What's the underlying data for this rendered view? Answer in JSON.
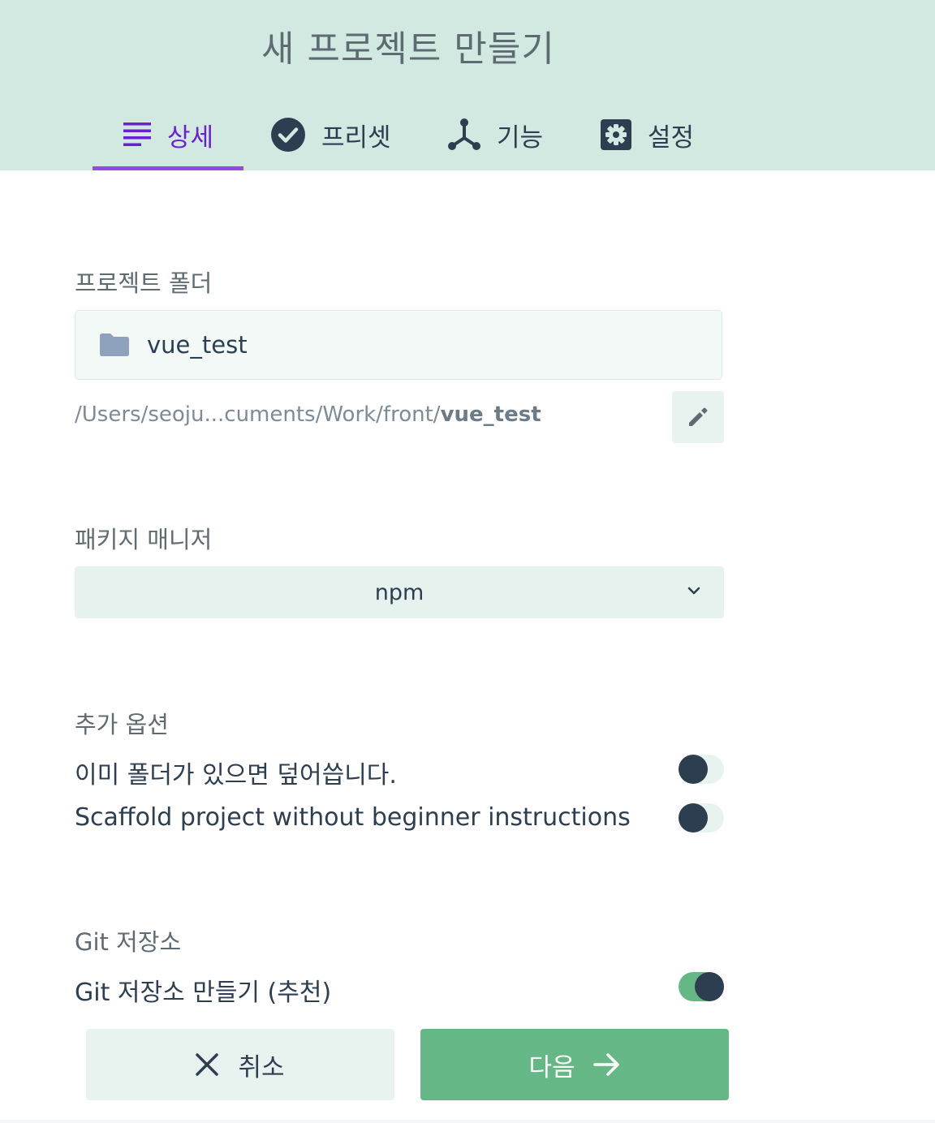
{
  "page": {
    "title": "새 프로젝트 만들기"
  },
  "tabs": [
    {
      "label": "상세",
      "icon": "list-icon",
      "active": true
    },
    {
      "label": "프리셋",
      "icon": "check-circle-icon",
      "active": false
    },
    {
      "label": "기능",
      "icon": "fork-icon",
      "active": false
    },
    {
      "label": "설정",
      "icon": "gear-icon",
      "active": false
    }
  ],
  "folder": {
    "label": "프로젝트 폴더",
    "value": "vue_test",
    "path_prefix": "/Users/seoju...cuments/Work/front/",
    "path_name": "vue_test"
  },
  "package_manager": {
    "label": "패키지 매니저",
    "selected": "npm"
  },
  "options": {
    "label": "추가 옵션",
    "items": [
      {
        "label": "이미 폴더가 있으면 덮어씁니다.",
        "enabled": false
      },
      {
        "label": "Scaffold project without beginner instructions",
        "enabled": false
      }
    ]
  },
  "git": {
    "label": "Git 저장소",
    "item": {
      "label": "Git 저장소 만들기 (추천)",
      "enabled": true
    }
  },
  "actions": {
    "cancel_label": "취소",
    "next_label": "다음"
  },
  "colors": {
    "header_bg": "#d1e9e0",
    "accent": "#6a1fd1",
    "primary": "#65b886",
    "text": "#2c3e50"
  }
}
